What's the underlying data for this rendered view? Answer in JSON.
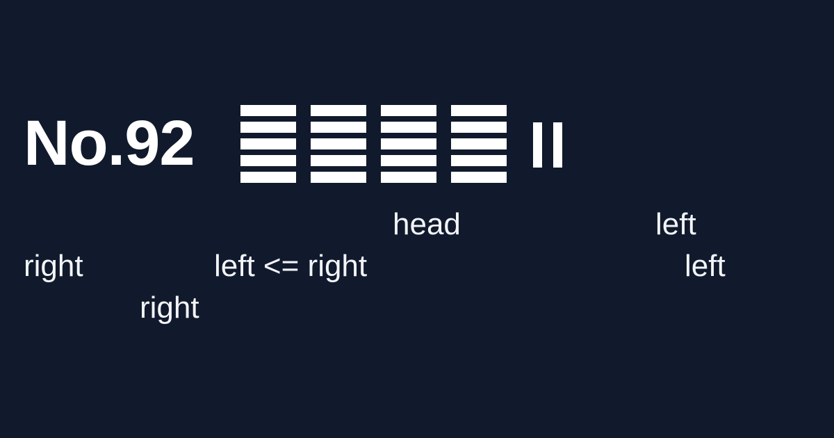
{
  "title": "No.92",
  "glyph_count": 4,
  "pause_symbol": "pause-bars-icon",
  "words": {
    "head": "head",
    "left_top": "left",
    "right_1": "right",
    "condition": "left <= right",
    "left_mid": "left",
    "right_2": "right"
  }
}
